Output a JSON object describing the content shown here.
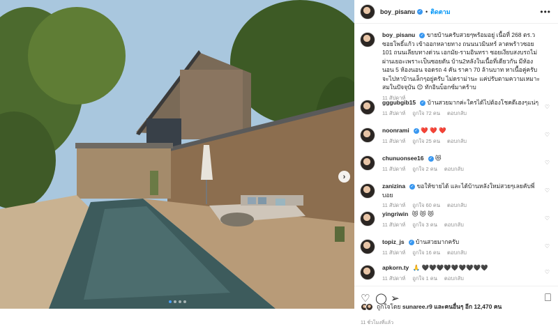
{
  "post": {
    "username": "boy_pisanu",
    "follow_label": "ติดตาม",
    "caption": "ขายบ้านครับสวยๆพร้อมอยู่ เนื้อที่ 268 ตร.ว ซอยโพธิ์แก้ว เข้าออกหลายทาง ถนนนวมินทร์ ลาดพร้าวซอย 101 ถนนเลียบทางด่วน เอกมัย-รามอินทรา ซอยเงียบสงบรถไม่ผ่านเยอะเพราะเป็นซอยตัน บ้าน2หลังในเนื้อที่เดียวกัน มีห้องนอน 5 ห้องนอน จอดรถ 4 คัน ราคา 70 ล้านบาท หาเนื้อคู่ครับ จะไปหาบ้านเล็กๆอยู่ครับ ไม่ดราม่านะ แค่ปรับตามความเหมาะสมในปัจจุบัน 😊 ทักอินบ็อกซ์มาคร้าบ",
    "caption_time": "11 สัปดาห์"
  },
  "comments": [
    {
      "user": "gggubgib15",
      "verified": true,
      "text": "บ้านสวยมากค่ะใครได้ไปต้องโชคดีเฮงๆแน่ๆ",
      "time": "11 สัปดาห์",
      "likes": "ถูกใจ 72 คน",
      "reply": "ตอบกลับ"
    },
    {
      "user": "noonrami",
      "verified": true,
      "text": "❤️ ❤️ ❤️",
      "time": "11 สัปดาห์",
      "likes": "ถูกใจ 25 คน",
      "reply": "ตอบกลับ"
    },
    {
      "user": "chunuonsee16",
      "verified": true,
      "text": "😻",
      "time": "11 สัปดาห์",
      "likes": "ถูกใจ 2 คน",
      "reply": "ตอบกลับ"
    },
    {
      "user": "zanizina",
      "verified": true,
      "text": "ขอให้ขายได้ และได้บ้านหลังใหม่สวยๆเลยคับพี่บอย",
      "time": "11 สัปดาห์",
      "likes": "ถูกใจ 60 คน",
      "reply": "ตอบกลับ"
    },
    {
      "user": "yingriwin",
      "verified": false,
      "text": "😻 😻 😻",
      "time": "11 สัปดาห์",
      "likes": "ถูกใจ 3 คน",
      "reply": "ตอบกลับ"
    },
    {
      "user": "topiz_js",
      "verified": true,
      "text": "บ้านสวยมากครับ",
      "time": "11 สัปดาห์",
      "likes": "ถูกใจ 16 คน",
      "reply": "ตอบกลับ"
    },
    {
      "user": "apkorn.ty",
      "verified": false,
      "text": "🙏 🖤🖤🖤🖤🖤🖤🖤🖤🖤",
      "time": "11 สัปดาห์",
      "likes": "ถูกใจ 1 คน",
      "reply": "ตอบกลับ"
    }
  ],
  "footer": {
    "liked_prefix": "ถูกใจโดย",
    "liked_user": "sunaree.r9",
    "liked_suffix": "และคนอื่นๆ อีก 12,470 คน",
    "time": "11 ชั่วโมงที่แล้ว"
  },
  "colors": {
    "accent": "#0095f6",
    "verified": "#3897f0",
    "like_red": "#ed4956"
  },
  "icons": [
    "heart-icon",
    "comment-icon",
    "share-icon",
    "bookmark-icon",
    "more-options-icon",
    "next-arrow-icon"
  ],
  "carousel": {
    "slides": 4,
    "current_slide": 1
  }
}
